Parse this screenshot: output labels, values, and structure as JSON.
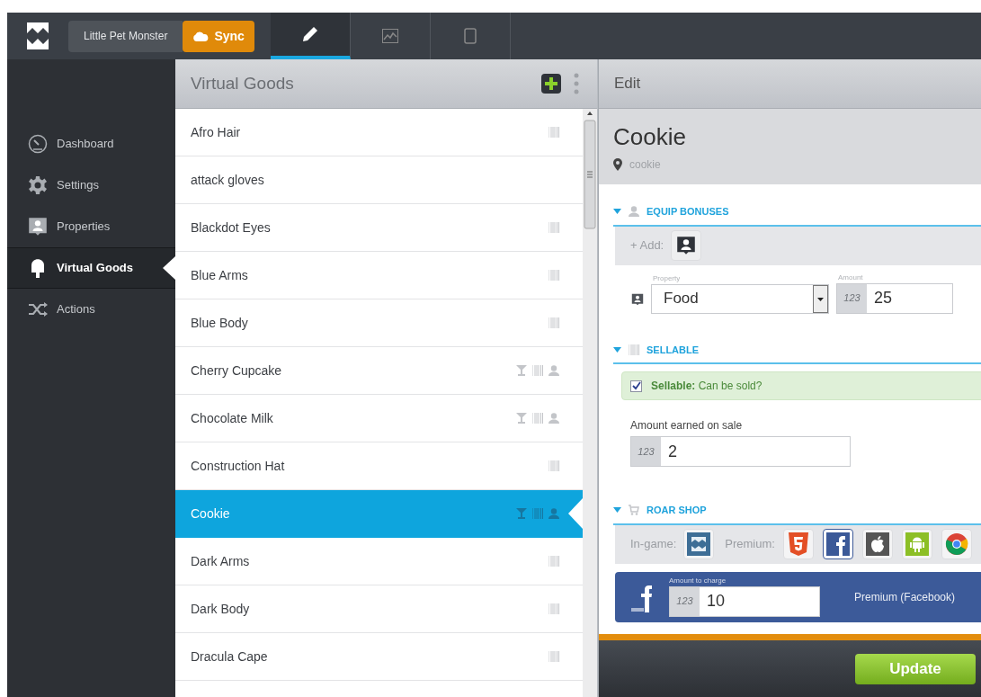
{
  "app": {
    "project": "Little Pet Monster",
    "sync": "Sync"
  },
  "tabs": [
    {
      "kind": "edit",
      "selected": true
    },
    {
      "kind": "analytics",
      "selected": false
    },
    {
      "kind": "device",
      "selected": false
    }
  ],
  "sidebar": {
    "items": [
      {
        "kind": "dashboard",
        "label": "Dashboard",
        "selected": false
      },
      {
        "kind": "settings",
        "label": "Settings",
        "selected": false
      },
      {
        "kind": "properties",
        "label": "Properties",
        "selected": false
      },
      {
        "kind": "goods",
        "label": "Virtual Goods",
        "selected": true
      },
      {
        "kind": "actions",
        "label": "Actions",
        "selected": false
      }
    ]
  },
  "list": {
    "title": "Virtual Goods",
    "items": [
      {
        "name": "Afro Hair",
        "badges": [
          {
            "kind": "sellable"
          }
        ],
        "selected": false
      },
      {
        "name": "attack gloves",
        "selected": false
      },
      {
        "name": "Blackdot Eyes",
        "badges": [
          {
            "kind": "sellable"
          }
        ],
        "selected": false
      },
      {
        "name": "Blue Arms",
        "badges": [
          {
            "kind": "sellable"
          }
        ],
        "selected": false
      },
      {
        "name": "Blue Body",
        "badges": [
          {
            "kind": "sellable"
          }
        ],
        "selected": false
      },
      {
        "name": "Cherry Cupcake",
        "badges": [
          {
            "kind": "consumable"
          },
          {
            "kind": "sellable"
          },
          {
            "kind": "equip"
          }
        ],
        "selected": false
      },
      {
        "name": "Chocolate Milk",
        "badges": [
          {
            "kind": "consumable"
          },
          {
            "kind": "sellable"
          },
          {
            "kind": "equip"
          }
        ],
        "selected": false
      },
      {
        "name": "Construction Hat",
        "badges": [
          {
            "kind": "sellable"
          }
        ],
        "selected": false
      },
      {
        "name": "Cookie",
        "badges": [
          {
            "kind": "consumable"
          },
          {
            "kind": "sellable"
          },
          {
            "kind": "equip"
          }
        ],
        "selected": true
      },
      {
        "name": "Dark Arms",
        "badges": [
          {
            "kind": "sellable"
          }
        ],
        "selected": false
      },
      {
        "name": "Dark Body",
        "badges": [
          {
            "kind": "sellable"
          }
        ],
        "selected": false
      },
      {
        "name": "Dracula Cape",
        "badges": [
          {
            "kind": "sellable"
          }
        ],
        "selected": false
      }
    ]
  },
  "edit": {
    "header": "Edit",
    "title": "Cookie",
    "id": "cookie",
    "equip": {
      "heading": "EQUIP BONUSES",
      "add": "+ Add:",
      "property_label": "Property",
      "property": "Food",
      "amount_label": "Amount",
      "amount_hint": "123",
      "amount": "25"
    },
    "sellable": {
      "heading": "SELLABLE",
      "checked": true,
      "label": "**Sellable:** Can be sold?",
      "earned_label": "Amount earned on sale",
      "earned_hint": "123",
      "earned": "2"
    },
    "shop": {
      "heading": "ROAR SHOP",
      "ingame_label": "In-game:",
      "premium_label": "Premium:",
      "ingame": [
        {
          "kind": "roar",
          "selected": false
        }
      ],
      "premium": [
        {
          "kind": "html5",
          "selected": false
        },
        {
          "kind": "facebook",
          "selected": true
        },
        {
          "kind": "apple",
          "selected": false
        },
        {
          "kind": "android",
          "selected": false
        },
        {
          "kind": "chrome",
          "selected": false
        }
      ],
      "charge_label": "Amount to charge",
      "charge_hint": "123",
      "charge": "10",
      "premium_name": "Premium (Facebook)"
    },
    "update": "Update"
  }
}
